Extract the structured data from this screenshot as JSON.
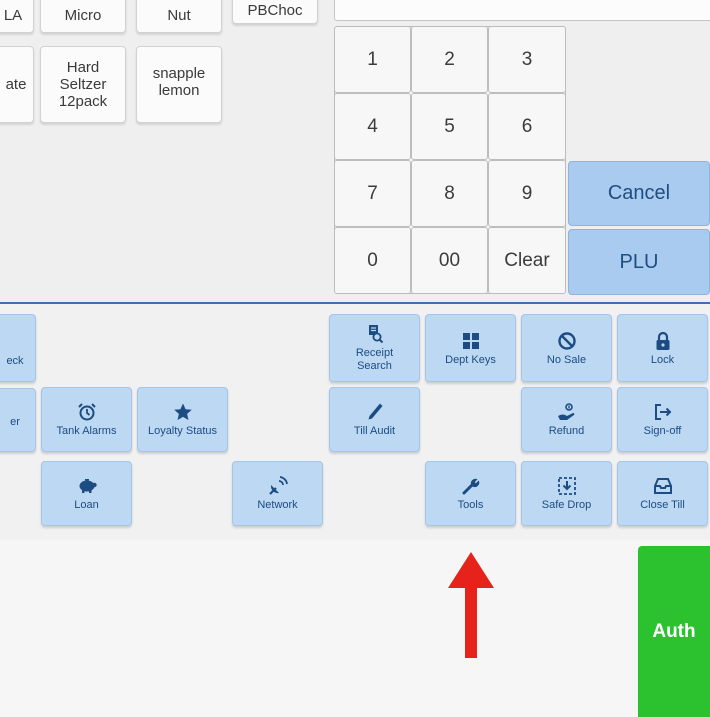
{
  "products": {
    "row1": [
      "LA",
      "Micro",
      "Nut",
      "PBChoc"
    ],
    "row2": [
      "ate",
      "Hard\nSeltzer\n12pack",
      "snapple\nlemon"
    ]
  },
  "keypad": {
    "digits": [
      "1",
      "2",
      "3",
      "4",
      "5",
      "6",
      "7",
      "8",
      "9",
      "0",
      "00"
    ],
    "clear": "Clear",
    "cancel": "Cancel",
    "plu": "PLU"
  },
  "functions": {
    "check_partial": "eck",
    "other_partial": "er",
    "tank_alarms": "Tank Alarms",
    "loyalty_status": "Loyalty Status",
    "loan": "Loan",
    "network": "Network",
    "receipt_search": "Receipt\nSearch",
    "till_audit": "Till Audit",
    "dept_keys": "Dept Keys",
    "tools": "Tools",
    "no_sale": "No Sale",
    "refund": "Refund",
    "safe_drop": "Safe Drop",
    "lock": "Lock",
    "sign_off": "Sign-off",
    "close_till": "Close Till"
  },
  "auth": "Auth",
  "colors": {
    "function_button": "#bcd8f3",
    "function_text": "#1d4c82",
    "keypad_accent": "#a8cbef",
    "divider": "#3e6fb0",
    "auth_green": "#2bc12f",
    "annotation_arrow": "#e5231b"
  },
  "annotation": {
    "arrow_points_to": "Tools"
  },
  "icons": {
    "receipt_search": "receipt-search-icon",
    "dept_keys": "grid-icon",
    "no_sale": "prohibited-icon",
    "lock": "lock-icon",
    "tank_alarms": "alarm-clock-icon",
    "loyalty_status": "star-icon",
    "till_audit": "pen-icon",
    "refund": "hand-money-icon",
    "sign_off": "sign-out-icon",
    "loan": "piggy-bank-icon",
    "network": "satellite-icon",
    "tools": "wrench-icon",
    "safe_drop": "safe-drop-icon",
    "close_till": "inbox-tray-icon"
  }
}
